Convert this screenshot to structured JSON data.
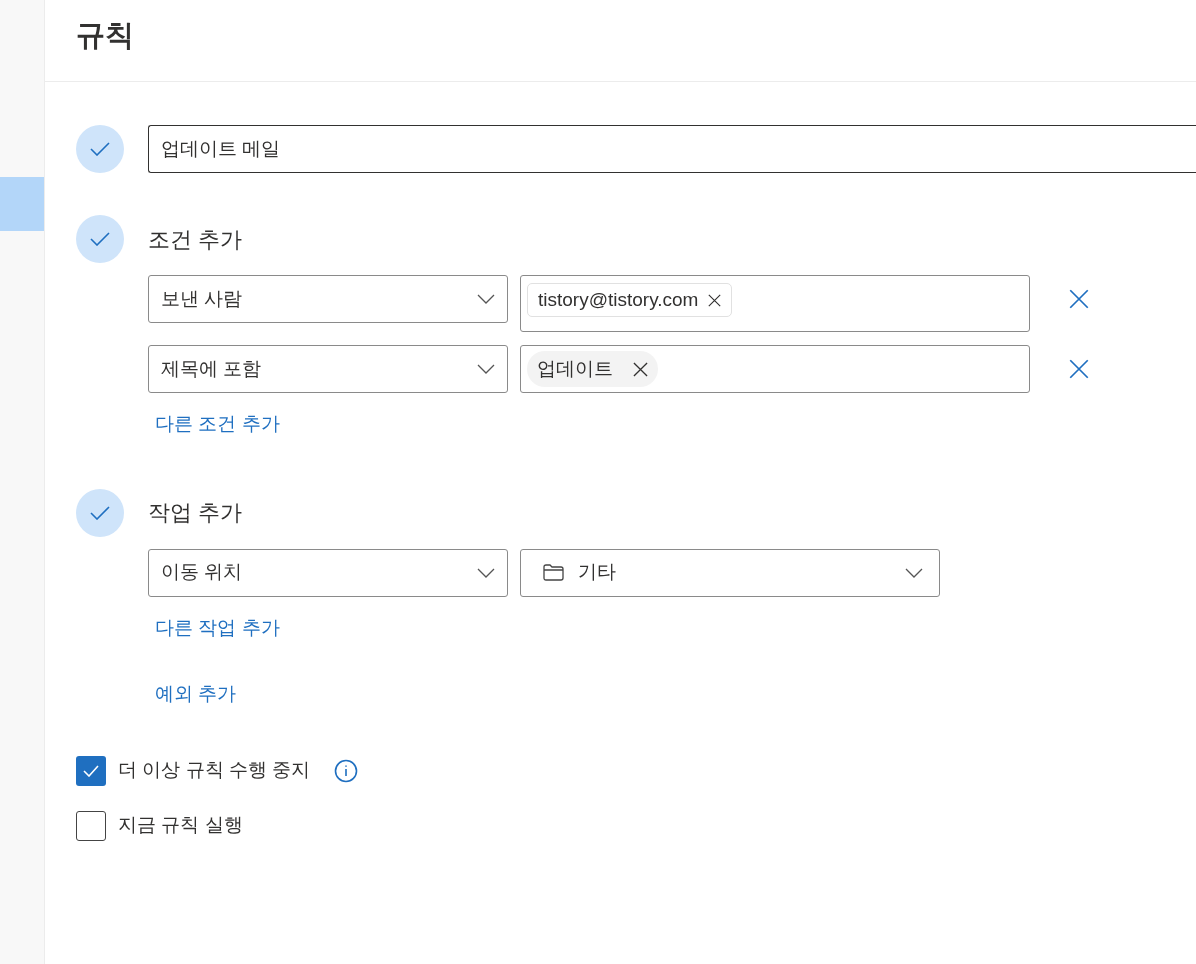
{
  "page_title": "규칙",
  "rule_name": {
    "value": "업데이트 메일",
    "done": true
  },
  "conditions": {
    "title": "조건 추가",
    "done": true,
    "rows": [
      {
        "field": "보낸 사람",
        "chips": [
          {
            "text": "tistory@tistory.com",
            "kind": "outlined"
          }
        ]
      },
      {
        "field": "제목에 포함",
        "chips": [
          {
            "text": "업데이트",
            "kind": "filled"
          }
        ]
      }
    ],
    "add_link": "다른 조건 추가"
  },
  "actions": {
    "title": "작업 추가",
    "done": true,
    "rows": [
      {
        "field": "이동 위치",
        "folder": "기타"
      }
    ],
    "add_link": "다른 작업 추가"
  },
  "exception_link": "예외 추가",
  "options": [
    {
      "label": "더 이상 규칙 수행 중지",
      "checked": true,
      "info": true
    },
    {
      "label": "지금 규칙 실행",
      "checked": false,
      "info": false
    }
  ]
}
